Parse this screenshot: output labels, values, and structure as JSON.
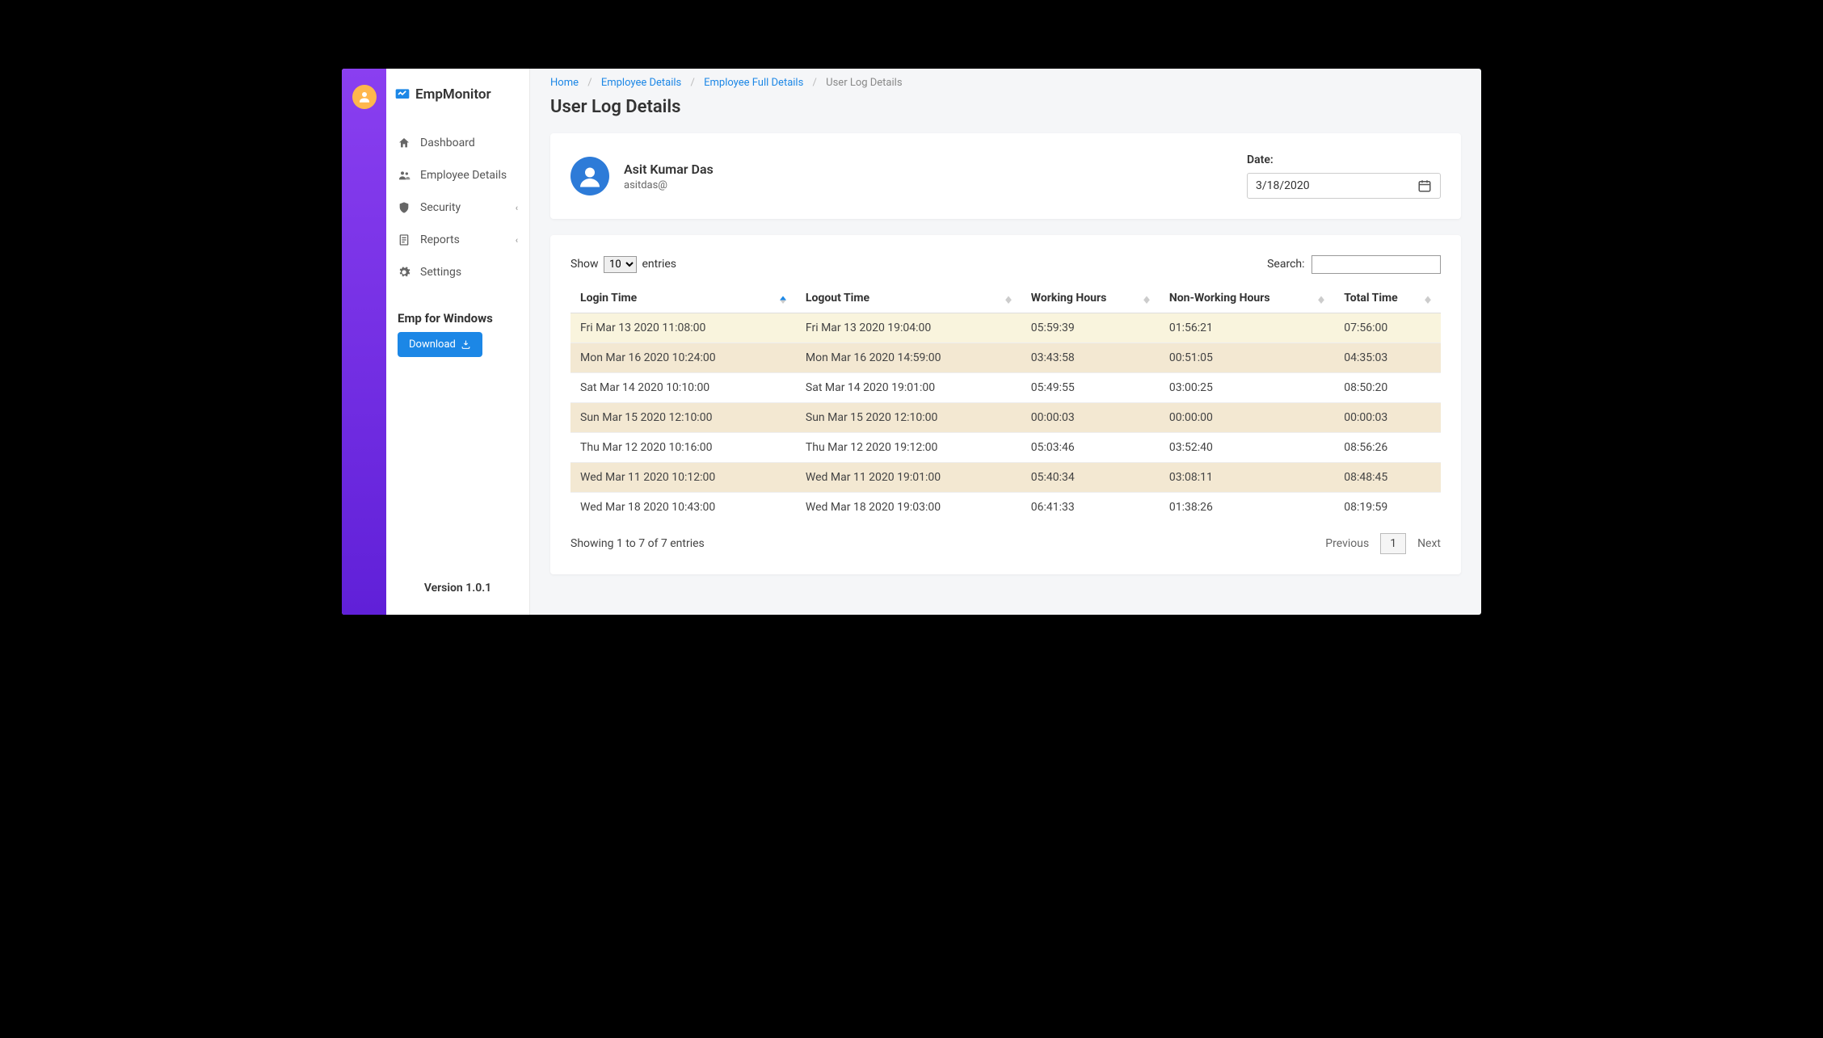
{
  "brand": "EmpMonitor",
  "sidebar": {
    "items": [
      {
        "label": "Dashboard",
        "expandable": false
      },
      {
        "label": "Employee Details",
        "expandable": false
      },
      {
        "label": "Security",
        "expandable": true
      },
      {
        "label": "Reports",
        "expandable": true
      },
      {
        "label": "Settings",
        "expandable": false
      }
    ],
    "download_title": "Emp for Windows",
    "download_btn": "Download",
    "version": "Version 1.0.1"
  },
  "breadcrumb": [
    {
      "text": "Home",
      "link": true
    },
    {
      "text": "Employee Details",
      "link": true
    },
    {
      "text": "Employee Full Details",
      "link": true
    },
    {
      "text": "User Log Details",
      "link": false
    }
  ],
  "page_title": "User Log Details",
  "user": {
    "name": "Asit Kumar Das",
    "email": "asitdas@"
  },
  "date_label": "Date:",
  "date_value": "3/18/2020",
  "table": {
    "show_prefix": "Show",
    "show_suffix": "entries",
    "page_size": "10",
    "search_label": "Search:",
    "columns": [
      "Login Time",
      "Logout Time",
      "Working Hours",
      "Non-Working Hours",
      "Total Time"
    ],
    "rows": [
      [
        "Fri Mar 13 2020 11:08:00",
        "Fri Mar 13 2020 19:04:00",
        "05:59:39",
        "01:56:21",
        "07:56:00"
      ],
      [
        "Mon Mar 16 2020 10:24:00",
        "Mon Mar 16 2020 14:59:00",
        "03:43:58",
        "00:51:05",
        "04:35:03"
      ],
      [
        "Sat Mar 14 2020 10:10:00",
        "Sat Mar 14 2020 19:01:00",
        "05:49:55",
        "03:00:25",
        "08:50:20"
      ],
      [
        "Sun Mar 15 2020 12:10:00",
        "Sun Mar 15 2020 12:10:00",
        "00:00:03",
        "00:00:00",
        "00:00:03"
      ],
      [
        "Thu Mar 12 2020 10:16:00",
        "Thu Mar 12 2020 19:12:00",
        "05:03:46",
        "03:52:40",
        "08:56:26"
      ],
      [
        "Wed Mar 11 2020 10:12:00",
        "Wed Mar 11 2020 19:01:00",
        "05:40:34",
        "03:08:11",
        "08:48:45"
      ],
      [
        "Wed Mar 18 2020 10:43:00",
        "Wed Mar 18 2020 19:03:00",
        "06:41:33",
        "01:38:26",
        "08:19:59"
      ]
    ],
    "info": "Showing 1 to 7 of 7 entries",
    "prev": "Previous",
    "next": "Next",
    "page": "1"
  }
}
